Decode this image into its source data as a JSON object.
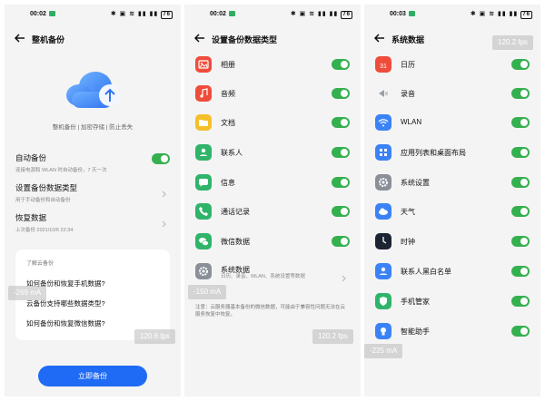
{
  "colors": {
    "toggle_on": "#35b04f",
    "primary": "#1f6bf5",
    "panel_bg": "#f4f4f4"
  },
  "panel1": {
    "status_time": "00:02",
    "battery": "76",
    "title": "整机备份",
    "caption": "整机备份 | 加密存储 | 防止丢失",
    "auto_backup": {
      "title": "自动备份",
      "subtitle": "连接电源和 WLAN 时自动备份，7 天一次"
    },
    "set_types": {
      "title": "设置备份数据类型",
      "subtitle": "用于手动备份和自动备份"
    },
    "restore": {
      "title": "恢复数据",
      "subtitle": "上次备份 2021/10/6 22:34"
    },
    "help": {
      "header": "了解云备份",
      "links": [
        "如何备份和恢复手机数据?",
        "云备份支持哪些数据类型?",
        "如何备份和恢复微信数据?"
      ]
    },
    "button": "立即备份",
    "overlay_ma": "-269 mA",
    "overlay_fps": "120.6 fps"
  },
  "panel2": {
    "status_time": "00:02",
    "battery": "76",
    "title": "设置备份数据类型",
    "items": [
      {
        "label": "相册",
        "icon": "photos-icon",
        "color": "#ef4c3c"
      },
      {
        "label": "音频",
        "icon": "music-icon",
        "color": "#ef4c3c"
      },
      {
        "label": "文档",
        "icon": "folder-icon",
        "color": "#f5bf2a"
      },
      {
        "label": "联系人",
        "icon": "contacts-icon",
        "color": "#2fb46a"
      },
      {
        "label": "信息",
        "icon": "messages-icon",
        "color": "#2fb46a"
      },
      {
        "label": "通话记录",
        "icon": "phone-icon",
        "color": "#2fb46a"
      },
      {
        "label": "微信数据",
        "icon": "wechat-icon",
        "color": "#2fb46a"
      }
    ],
    "system_data": {
      "label": "系统数据",
      "desc": "日历、录音、WLAN、系统设置等数据",
      "icon": "gear-icon",
      "color": "#8a8f98"
    },
    "note": "注意：云服务器基本备份的微信数据，可能由于兼容性问题无法在云服务恢复中恢复。",
    "overlay_ma": "-150 mA",
    "overlay_fps": "120.2 fps"
  },
  "panel3": {
    "status_time": "00:03",
    "battery": "76",
    "title": "系统数据",
    "calendar_day": "31",
    "items": [
      {
        "label": "日历",
        "icon": "calendar-icon",
        "color": "#ef4c3c"
      },
      {
        "label": "录音",
        "icon": "recorder-icon",
        "color": "#b9bdc4"
      },
      {
        "label": "WLAN",
        "icon": "wifi-icon",
        "color": "#3b82f6"
      },
      {
        "label": "应用列表和桌面布局",
        "icon": "apps-icon",
        "color": "#3b82f6"
      },
      {
        "label": "系统设置",
        "icon": "gear-icon",
        "color": "#8a8f98"
      },
      {
        "label": "天气",
        "icon": "weather-icon",
        "color": "#3b82f6"
      },
      {
        "label": "时钟",
        "icon": "clock-icon",
        "color": "#1c2433"
      },
      {
        "label": "联系人黑白名单",
        "icon": "contacts-icon",
        "color": "#3b82f6"
      },
      {
        "label": "手机管家",
        "icon": "shield-icon",
        "color": "#2fb46a"
      },
      {
        "label": "智能助手",
        "icon": "bulb-icon",
        "color": "#3b82f6"
      }
    ],
    "overlay_fps": "120.2 fps",
    "overlay_ma": "-225 mA"
  }
}
